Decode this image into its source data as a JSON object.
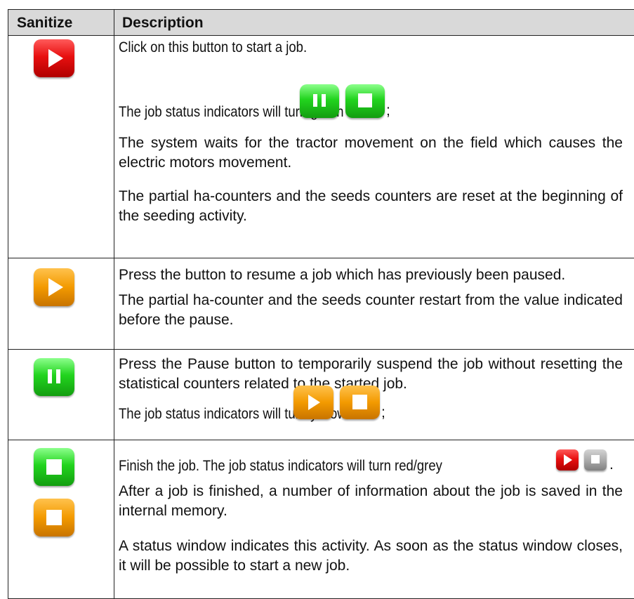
{
  "header": {
    "col1": "Sanitize",
    "col2": "Description"
  },
  "rows": [
    {
      "icon": "red-play-button",
      "paragraphs": [
        "Click on this button to start a job.",
        "The job status indicators will turn green",
        "The system waits for the tractor movement on the field which causes the electric motors movement.",
        "The partial ha-counters and the seeds counters are reset at the beginning of the seeding activity."
      ],
      "inline_suffix": ";",
      "inline_icons": [
        "green-pause-icon",
        "green-stop-icon"
      ]
    },
    {
      "icon": "orange-play-button",
      "paragraphs": [
        "Press the button to resume a job which has previously been paused.",
        "The partial ha-counter and the seeds counter restart from the value indicated before the pause."
      ]
    },
    {
      "icon": "green-pause-button",
      "paragraphs": [
        "Press the Pause button to temporarily suspend the job without resetting the statistical counters related to the started job.",
        "The job status indicators will turn yellow"
      ],
      "inline_suffix": ";",
      "inline_icons": [
        "orange-play-icon",
        "orange-stop-icon"
      ]
    },
    {
      "icons": [
        "green-stop-button",
        "orange-stop-button"
      ],
      "paragraphs": [
        "Finish the job. The job status indicators will turn red/grey",
        "After a job is finished, a number of information about the job is saved in the internal memory.",
        "A status window indicates this activity. As soon as the status window closes, it will be possible to start a new job."
      ],
      "inline_suffix": ".",
      "inline_icons": [
        "red-play-icon",
        "grey-stop-icon"
      ]
    }
  ],
  "colors": {
    "header_bg": "#d9d9d9",
    "red": "#e81010",
    "orange": "#f39a00",
    "green": "#22d41e",
    "grey": "#a8a8a8"
  }
}
